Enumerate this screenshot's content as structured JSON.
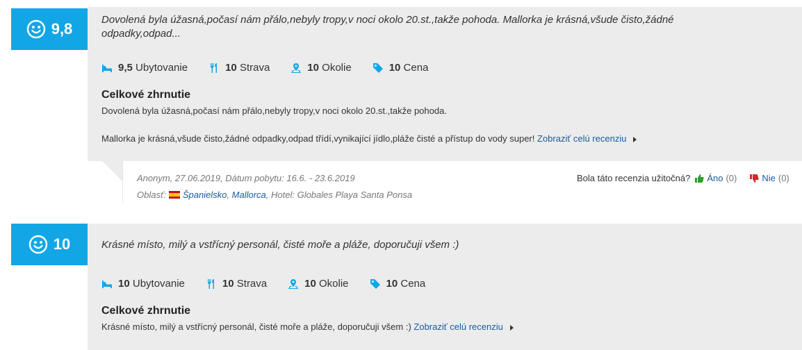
{
  "reviews": [
    {
      "score": "9,8",
      "quote_line1": "Dovolená byla úžasná,počasí nám přálo,nebyly tropy,v noci okolo 20.st.,takže pohoda. Mallorka je krásná,všude čisto,žádné",
      "quote_line2": "odpadky,odpad...",
      "ratings": [
        {
          "value": "9,5",
          "label": "Ubytovanie",
          "icon": "bed-icon"
        },
        {
          "value": "10",
          "label": "Strava",
          "icon": "fork-knife-icon"
        },
        {
          "value": "10",
          "label": "Okolie",
          "icon": "map-pin-icon"
        },
        {
          "value": "10",
          "label": "Cena",
          "icon": "price-tag-icon"
        }
      ],
      "summary_title": "Celkové zhrnutie",
      "summary_p1": "Dovolená byla úžasná,počasí nám přálo,nebyly tropy,v noci okolo 20.st.,takže pohoda.",
      "summary_p2": "Mallorka je krásná,všude čisto,žádné odpadky,odpad třídí,vynikající jídlo,pláže čisté a přístup do vody super!",
      "show_full_link": "Zobraziť celú recenziu",
      "meta": {
        "line1": "Anonym, 27.06.2019, Dátum pobytu: 16.6. - 23.6.2019",
        "area_label": "Oblasť:",
        "country": "Španielsko",
        "region": "Mallorca",
        "hotel": ", Hotel: Globales Playa Santa Ponsa",
        "useful_question": "Bola táto recenzia užitočná?",
        "yes_label": "Áno",
        "yes_count": "(0)",
        "no_label": "Nie",
        "no_count": "(0)"
      }
    },
    {
      "score": "10",
      "quote_line1": "Krásné místo, milý a vstřícný personál, čisté moře a pláže, doporučuji všem :)",
      "ratings": [
        {
          "value": "10",
          "label": "Ubytovanie",
          "icon": "bed-icon"
        },
        {
          "value": "10",
          "label": "Strava",
          "icon": "fork-knife-icon"
        },
        {
          "value": "10",
          "label": "Okolie",
          "icon": "map-pin-icon"
        },
        {
          "value": "10",
          "label": "Cena",
          "icon": "price-tag-icon"
        }
      ],
      "summary_title": "Celkové zhrnutie",
      "summary_p1": "Krásné místo, milý a vstřícný personál, čisté moře a pláže, doporučuji všem :)",
      "show_full_link": "Zobraziť celú recenziu"
    }
  ],
  "colors": {
    "accent": "#13a6e6",
    "card": "#ececec",
    "link": "#1a5aa0"
  }
}
